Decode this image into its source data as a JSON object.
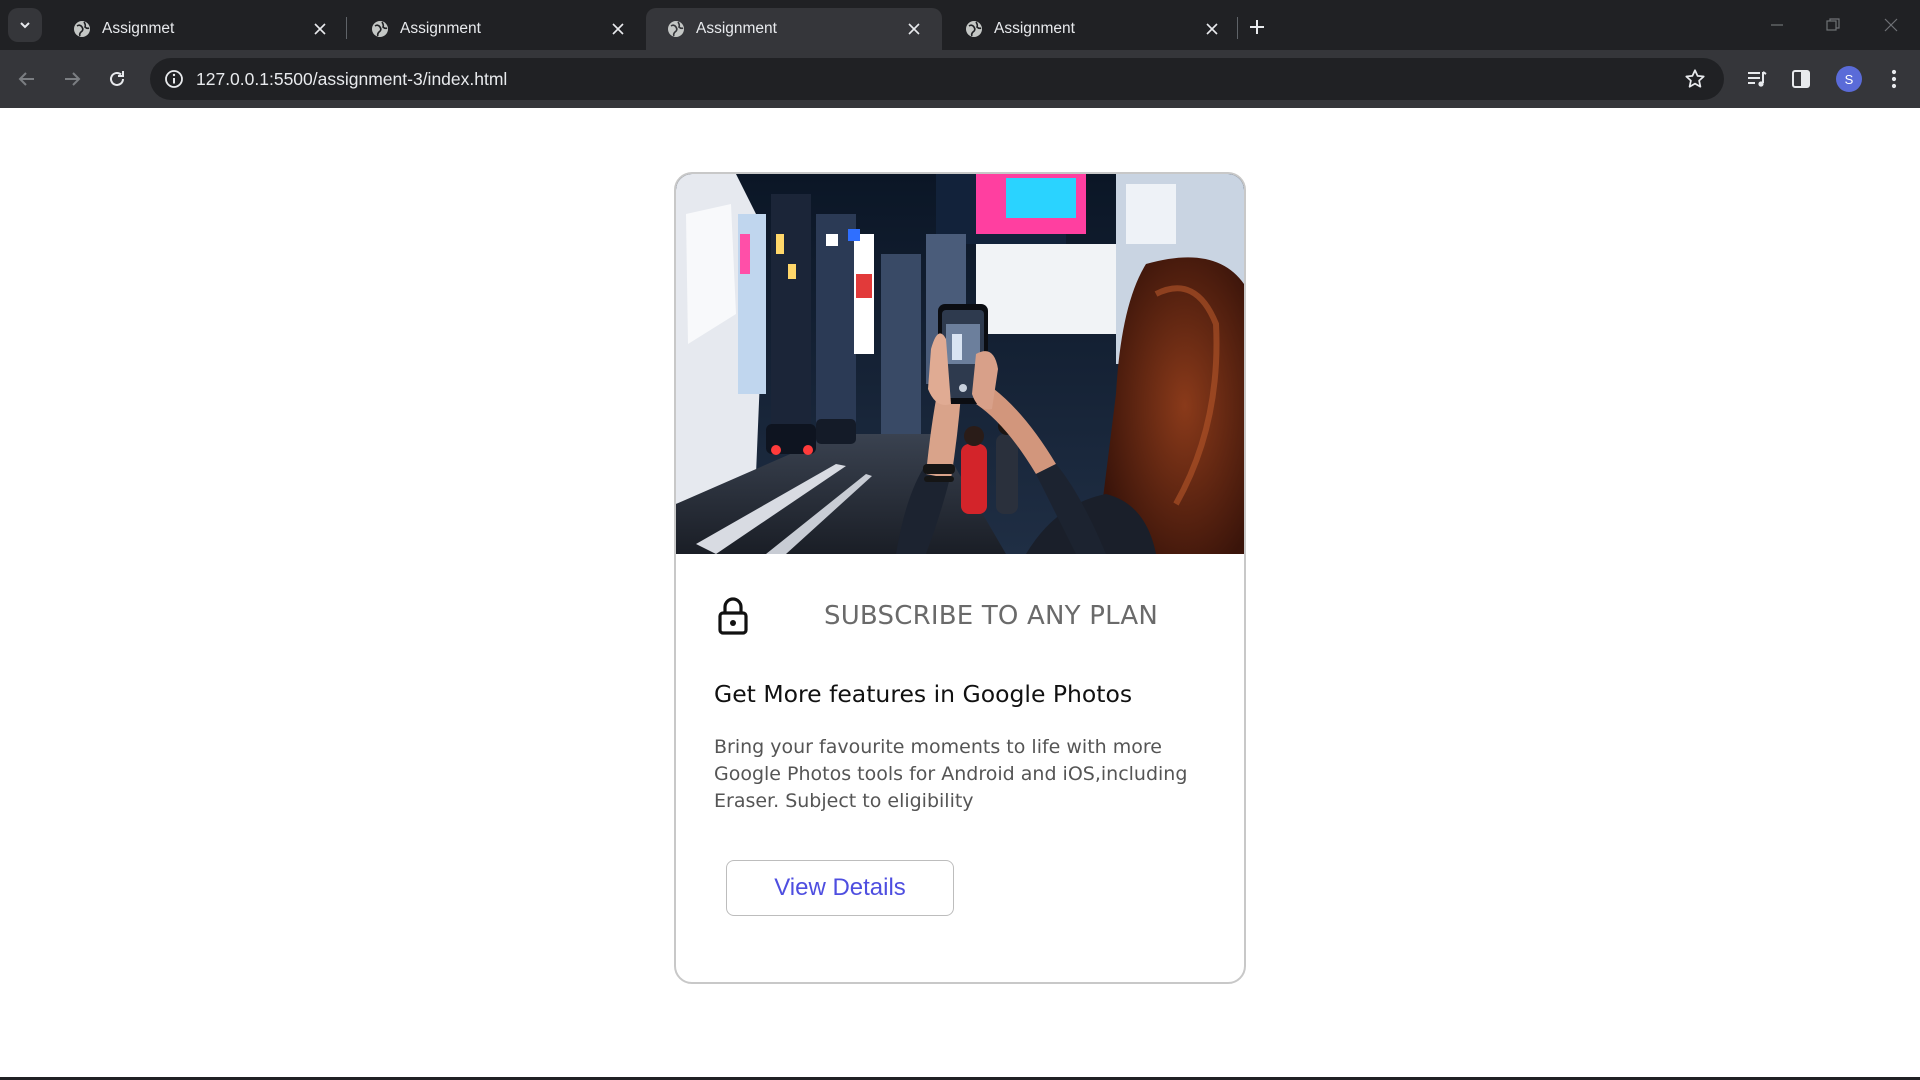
{
  "browser": {
    "tabs": [
      {
        "title": "Assignmet",
        "active": false
      },
      {
        "title": "Assignment",
        "active": false
      },
      {
        "title": "Assignment",
        "active": true
      },
      {
        "title": "Assignment",
        "active": false
      }
    ],
    "url": "127.0.0.1:5500/assignment-3/index.html",
    "profile_initial": "S",
    "icons": {
      "tab_search": "chevron-down-icon",
      "favicon": "globe-icon",
      "close": "close-icon",
      "new_tab": "plus-icon",
      "back": "arrow-left-icon",
      "forward": "arrow-right-icon",
      "reload": "reload-icon",
      "site_info": "info-icon",
      "bookmark": "star-icon",
      "media": "media-queue-icon",
      "side_panel": "side-panel-icon",
      "menu": "kebab-menu-icon"
    }
  },
  "card": {
    "image_alt": "Person photographing a neon city street at night with a smartphone",
    "lock_icon": "lock-icon",
    "plan_label": "SUBSCRIBE TO ANY PLAN",
    "title": "Get More features in Google Photos",
    "description": "Bring your favourite moments to life with more Google Photos tools for Android and iOS,including Eraser. Subject to eligibility",
    "button_label": "View Details"
  },
  "colors": {
    "chrome_dark": "#202124",
    "chrome_toolbar": "#35363a",
    "button_text": "#4e4ee0",
    "avatar": "#5a6bd8",
    "card_border": "#c8c8c8"
  }
}
